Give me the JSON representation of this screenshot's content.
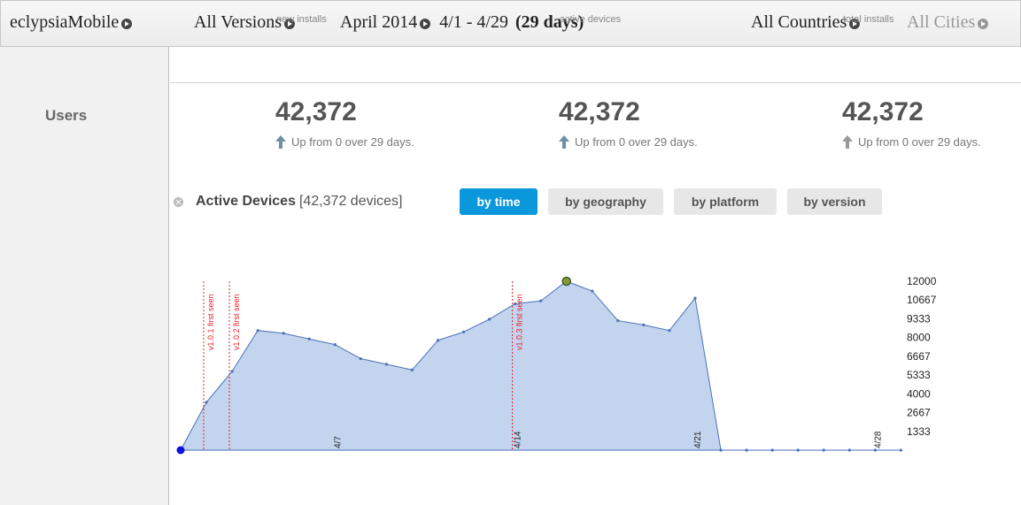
{
  "topbar": {
    "app": "eclypsiaMobile",
    "versions": "All Versions",
    "month": "April 2014",
    "range": "4/1 - 4/29",
    "days": "(29 days)",
    "countries": "All Countries",
    "cities": "All Cities"
  },
  "sidebar": {
    "users_label": "Users"
  },
  "stats": [
    {
      "label": "new installs",
      "value": "42,372",
      "sub": "Up from 0 over 29 days.",
      "arrow_color": "#6f8fa8"
    },
    {
      "label": "active devices",
      "value": "42,372",
      "sub": "Up from 0 over 29 days.",
      "arrow_color": "#6f8fa8"
    },
    {
      "label": "total installs",
      "value": "42,372",
      "sub": "Up from 0 over 29 days.",
      "arrow_color": "#999999"
    }
  ],
  "section": {
    "title": "Active Devices",
    "count": "[42,372 devices]"
  },
  "tabs": [
    {
      "label": "by time",
      "active": true
    },
    {
      "label": "by geography",
      "active": false
    },
    {
      "label": "by platform",
      "active": false
    },
    {
      "label": "by version",
      "active": false
    }
  ],
  "colors": {
    "accent": "#0a97db",
    "area_fill": "#c3d4ee",
    "line": "#4a72b8",
    "marker": "#e8202a"
  },
  "chart_data": {
    "type": "area",
    "x_ticks": [
      "4/7",
      "4/14",
      "4/21",
      "4/28"
    ],
    "y_ticks": [
      1333,
      2667,
      4000,
      5333,
      6667,
      8000,
      9333,
      10667,
      12000
    ],
    "ylim": [
      0,
      12000
    ],
    "x": [
      "4/1",
      "4/2",
      "4/3",
      "4/4",
      "4/5",
      "4/6",
      "4/7",
      "4/8",
      "4/9",
      "4/10",
      "4/11",
      "4/12",
      "4/13",
      "4/14",
      "4/15",
      "4/16",
      "4/17",
      "4/18",
      "4/19",
      "4/20",
      "4/21",
      "4/22",
      "4/23",
      "4/24",
      "4/25",
      "4/26",
      "4/27",
      "4/28",
      "4/29"
    ],
    "values": [
      0,
      3400,
      5600,
      8500,
      8300,
      7900,
      7500,
      6500,
      6100,
      5700,
      7800,
      8400,
      9300,
      10400,
      10600,
      12000,
      11300,
      9200,
      8900,
      8500,
      10800,
      0,
      0,
      0,
      0,
      0,
      0,
      0,
      0
    ],
    "annotations": [
      {
        "x": "4/1",
        "label": "v1.0.1 first seen"
      },
      {
        "x": "4/2",
        "label": "v1.0.2 first seen"
      },
      {
        "x": "4/13",
        "label": "v1.0.3 first seen"
      }
    ]
  }
}
